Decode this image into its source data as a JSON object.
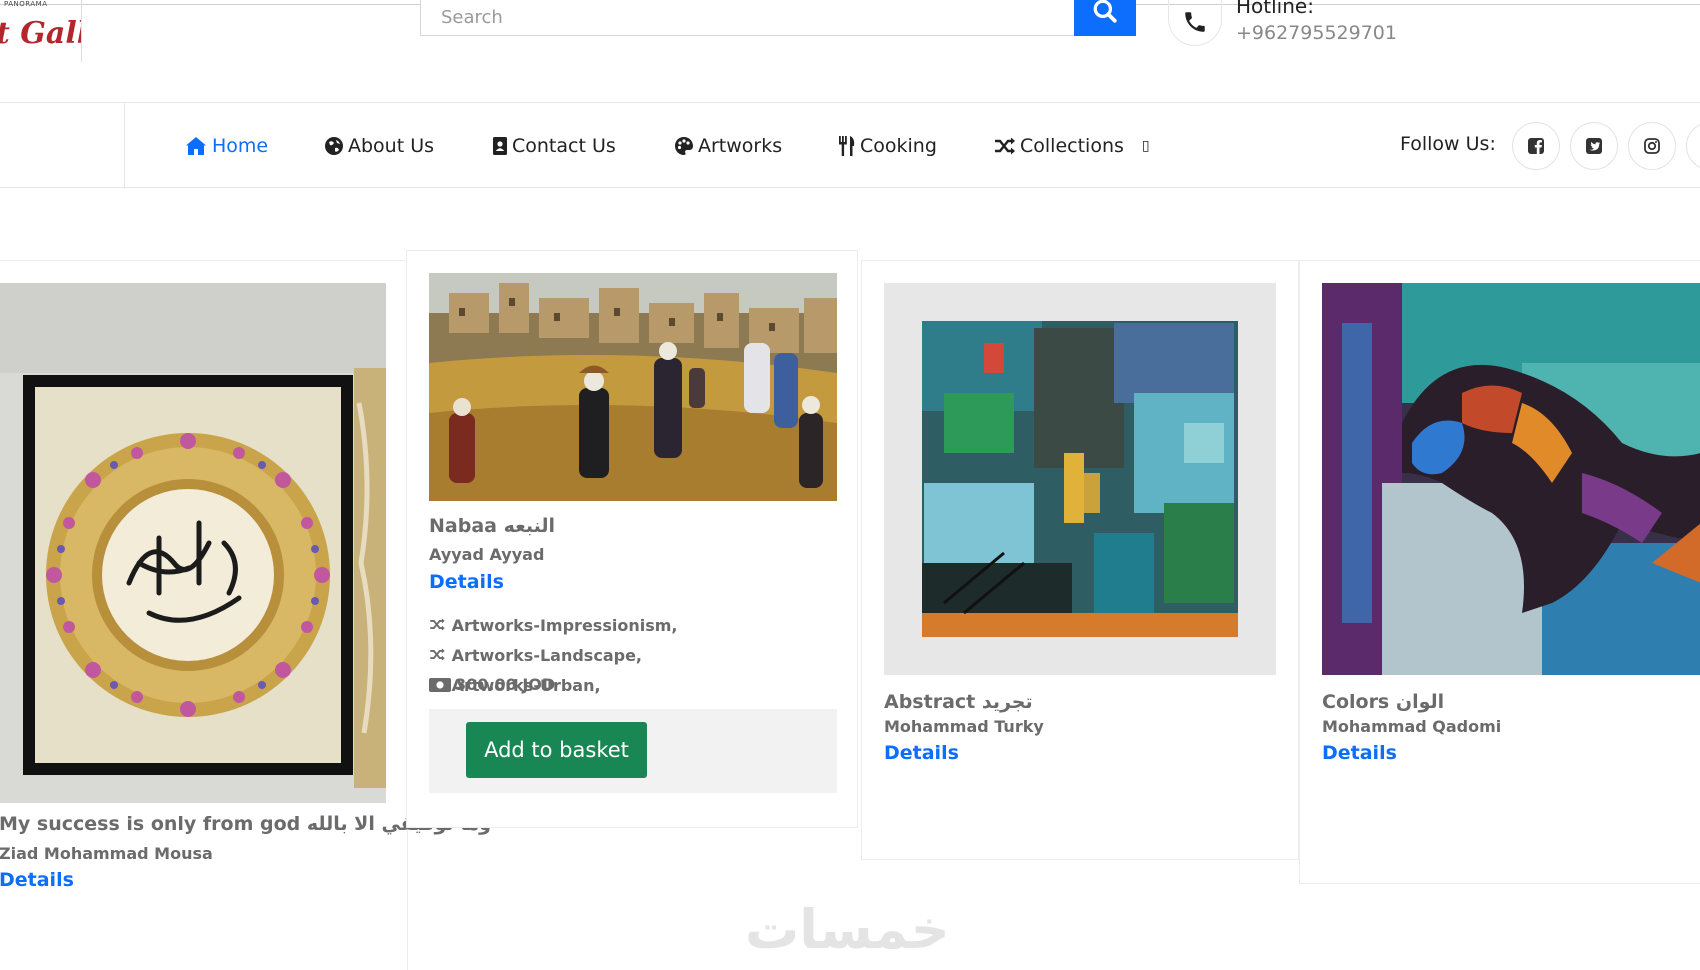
{
  "header": {
    "logo_small": "PANORAMA",
    "logo_text": "t Gallery",
    "search_placeholder": "Search",
    "hotline_label": "Hotline:",
    "hotline_number": "+962795529701"
  },
  "nav": {
    "items": [
      {
        "label": "Home",
        "icon": "home-icon",
        "active": true
      },
      {
        "label": "About Us",
        "icon": "globe-icon"
      },
      {
        "label": "Contact Us",
        "icon": "address-book-icon"
      },
      {
        "label": "Artworks",
        "icon": "palette-icon"
      },
      {
        "label": "Cooking",
        "icon": "utensils-icon"
      },
      {
        "label": "Collections",
        "icon": "shuffle-icon"
      }
    ],
    "collections_caret": "▯",
    "follow_label": "Follow Us:",
    "social": [
      "facebook-icon",
      "twitter-icon",
      "instagram-icon"
    ]
  },
  "cards": [
    {
      "title": "My success is only from god وما توفيقي الا بالله",
      "artist": "Ziad Mohammad Mousa",
      "details": "Details"
    },
    {
      "title": "Nabaa النبعه",
      "artist": "Ayyad Ayyad",
      "details": "Details",
      "tags": [
        "Artworks-Impressionism,",
        "Artworks-Landscape,",
        "Artworks-Urban,"
      ],
      "price": "300.00 JOD",
      "basket": "Add to basket"
    },
    {
      "title": "Abstract تجريد",
      "artist": "Mohammad Turky",
      "details": "Details"
    },
    {
      "title": "Colors الوان",
      "artist": "Mohammad Qadomi",
      "details": "Details"
    }
  ],
  "watermark": "خمسات",
  "colors": {
    "primary": "#0d6efd",
    "basket": "#198754",
    "muted_text": "#6b6b6b"
  }
}
